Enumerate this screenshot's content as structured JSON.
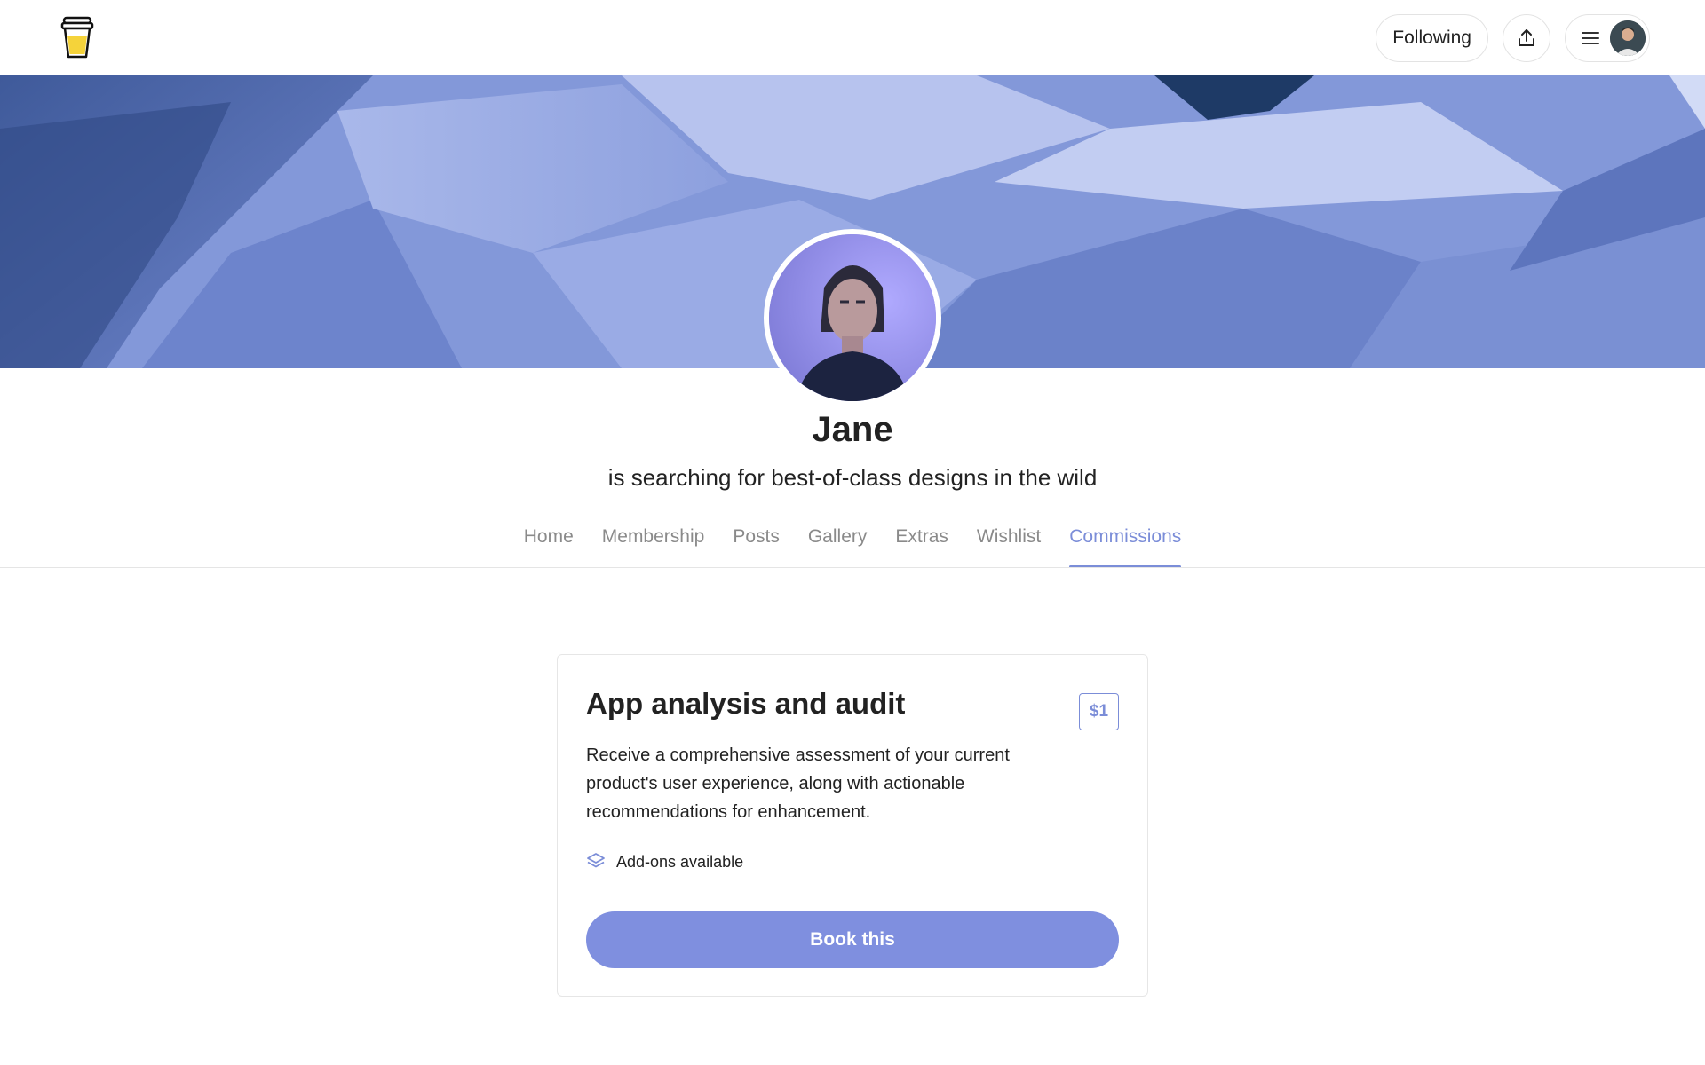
{
  "header": {
    "following_label": "Following",
    "share_icon": "share-icon",
    "menu_icon": "hamburger-menu-icon"
  },
  "profile": {
    "name": "Jane",
    "tagline": "is searching for best-of-class designs in the wild"
  },
  "tabs": [
    {
      "label": "Home",
      "active": false
    },
    {
      "label": "Membership",
      "active": false
    },
    {
      "label": "Posts",
      "active": false
    },
    {
      "label": "Gallery",
      "active": false
    },
    {
      "label": "Extras",
      "active": false
    },
    {
      "label": "Wishlist",
      "active": false
    },
    {
      "label": "Commissions",
      "active": true
    }
  ],
  "commission": {
    "title": "App analysis and audit",
    "price": "$1",
    "description": "Receive a comprehensive assessment of your current product's user experience, along with actionable recommendations for enhancement.",
    "addons_label": "Add-ons available",
    "book_label": "Book this"
  },
  "colors": {
    "accent": "#7b8dd8",
    "button": "#7f8fdf",
    "logo_cup": "#f5d33a"
  }
}
